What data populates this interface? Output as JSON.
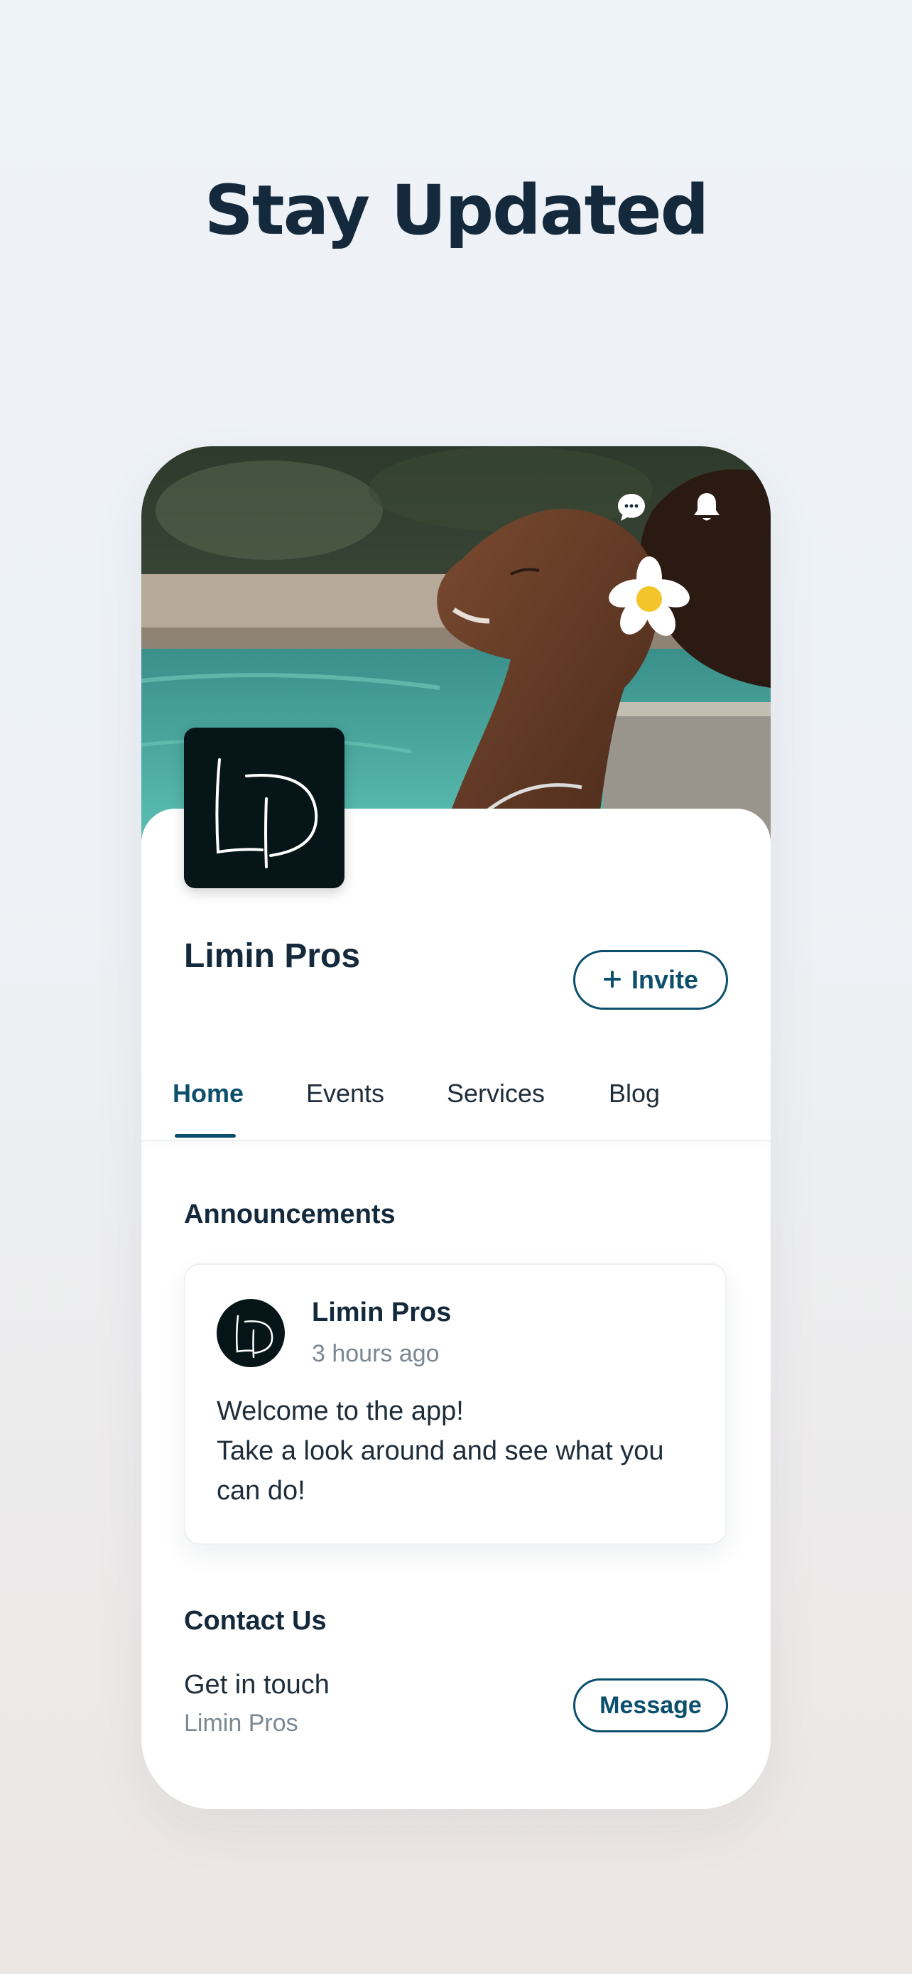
{
  "headline": "Stay Updated",
  "header": {
    "icons": [
      "chat-bubble-icon",
      "bell-icon"
    ]
  },
  "profile": {
    "name": "Limin Pros",
    "invite_label": "Invite",
    "invite_icon": "plus-icon"
  },
  "tabs": [
    {
      "label": "Home",
      "active": true
    },
    {
      "label": "Events",
      "active": false
    },
    {
      "label": "Services",
      "active": false
    },
    {
      "label": "Blog",
      "active": false
    }
  ],
  "announcements": {
    "title": "Announcements",
    "post": {
      "author": "Limin Pros",
      "time": "3 hours ago",
      "lines": [
        "Welcome to the app!",
        "Take a look around and see what you",
        "can do!"
      ]
    }
  },
  "contact": {
    "title": "Contact Us",
    "line": "Get in touch",
    "sub": "Limin Pros",
    "button_label": "Message"
  },
  "colors": {
    "accent": "#0b4f6c",
    "text_primary": "#142a3c",
    "text_secondary": "#7b8793",
    "logo_bg": "#061618"
  }
}
